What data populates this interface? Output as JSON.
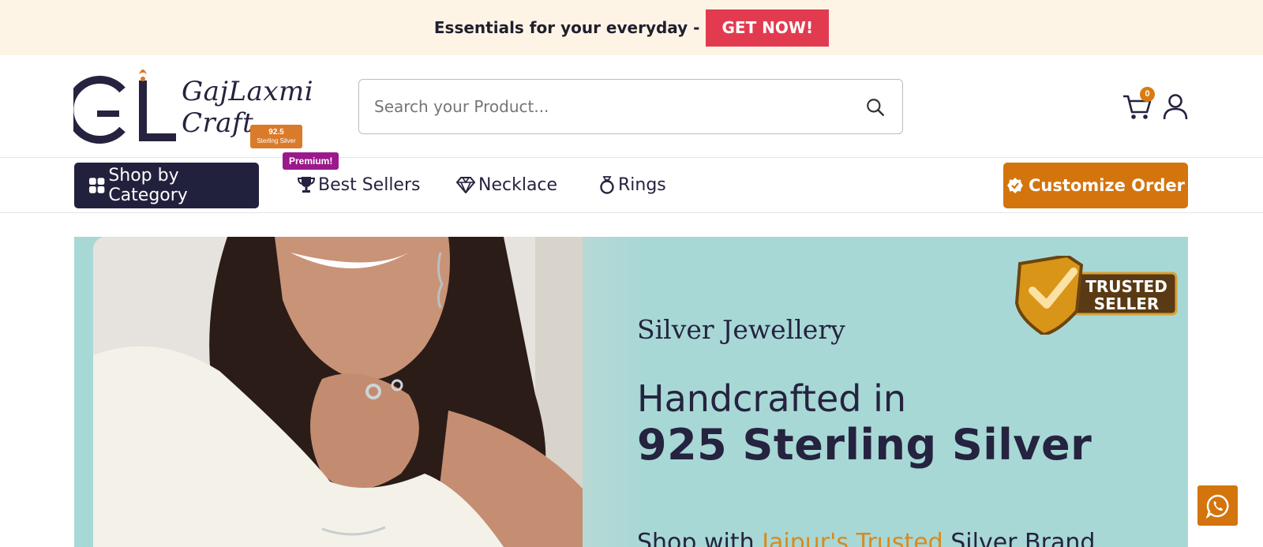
{
  "announcement": {
    "text": "Essentials for your everyday -",
    "cta_label": "GET NOW!"
  },
  "header": {
    "logo": {
      "name_line1": "GajLaxmi",
      "name_line2": "Craft",
      "badge_line1": "92.5",
      "badge_line2": "Sterling Silver"
    },
    "search": {
      "placeholder": "Search your Product..."
    },
    "cart_count": "0"
  },
  "nav": {
    "shop_by_category": "Shop by Category",
    "premium_badge": "Premium!",
    "items": [
      {
        "label": "Best Sellers",
        "icon": "trophy-icon"
      },
      {
        "label": "Necklace",
        "icon": "diamond-icon"
      },
      {
        "label": "Rings",
        "icon": "ring-icon"
      }
    ],
    "customize_order": "Customize Order"
  },
  "hero": {
    "subtitle": "Silver Jewellery",
    "line1": "Handcrafted in",
    "line2": "925 Sterling  Silver",
    "line3_prefix": "Shop with ",
    "line3_accent": "Jaipur's Trusted",
    "line3_suffix": " Silver Brand",
    "badge_line1": "TRUSTED",
    "badge_line2": "SELLER"
  },
  "colors": {
    "brand_navy": "#22213d",
    "brand_orange": "#d3740d",
    "cta_red": "#e23b50",
    "premium_purple": "#9a1a8c",
    "hero_teal": "#a7d8d6"
  }
}
